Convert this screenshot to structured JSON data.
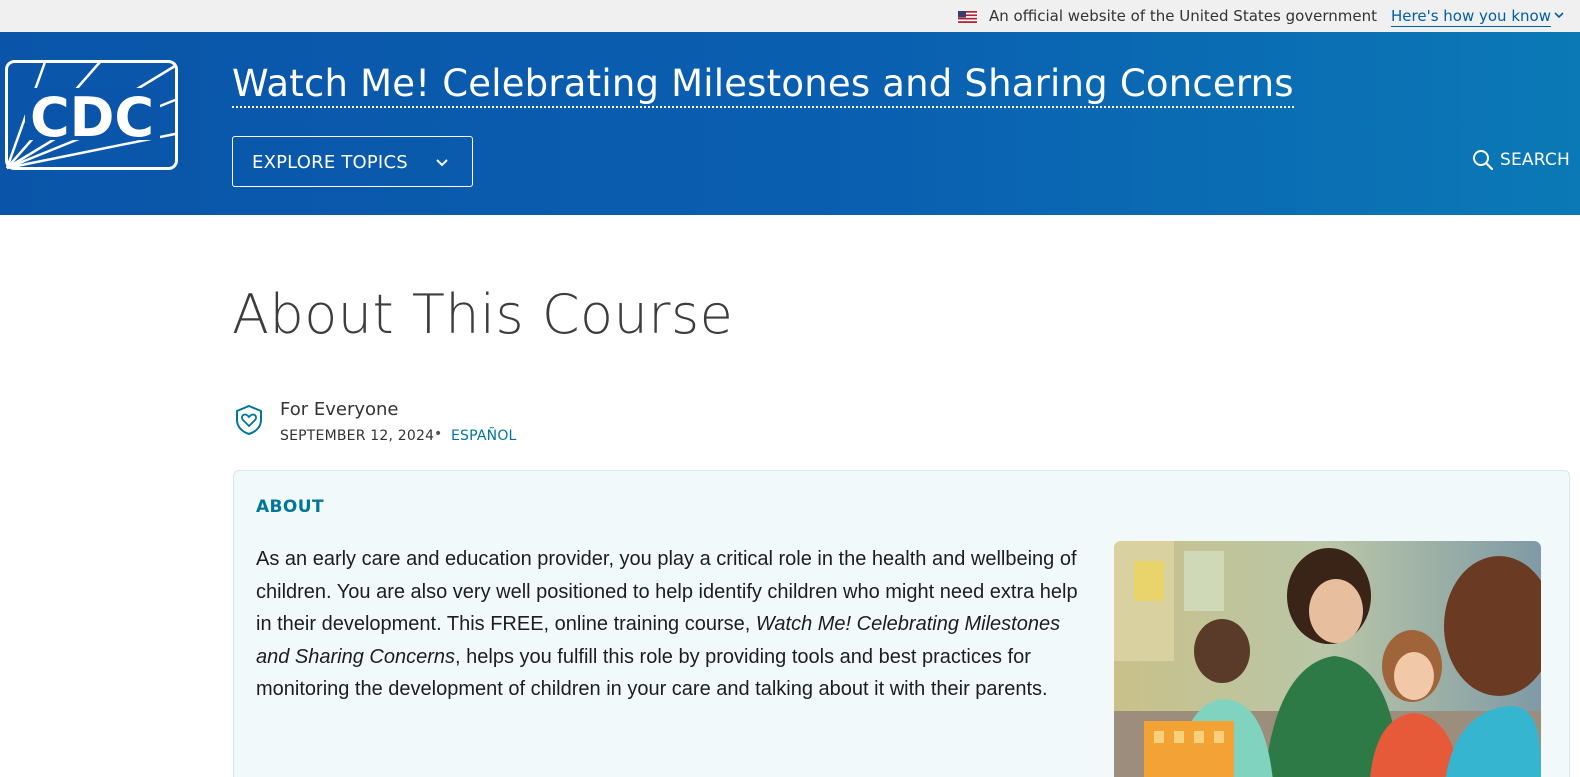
{
  "gov_banner": {
    "official_text": "An official website of the United States government",
    "how_you_know_link": "Here's how you know"
  },
  "header": {
    "logo_text": "CDC",
    "site_title": "Watch Me! Celebrating Milestones and Sharing Concerns",
    "explore_label": "EXPLORE TOPICS",
    "search_label": "SEARCH"
  },
  "page": {
    "title": "About This Course",
    "audience": "For Everyone",
    "date": "SEPTEMBER 12, 2024",
    "separator": "•",
    "language_link": "ESPAÑOL"
  },
  "about": {
    "heading": "ABOUT",
    "text_before_italic": "As an early care and education provider, you play a critical role in the health and wellbeing of children. You are also very well positioned to help identify children who might need extra help in their development. This FREE, online training course, ",
    "text_italic": "Watch Me! Celebrating Milestones and Sharing Concerns",
    "text_after_italic": ", helps you fulfill this role by providing tools and best practices for monitoring the development of children in your care and talking about it with their parents."
  },
  "colors": {
    "header_start": "#0a55a9",
    "header_end": "#0b79b6",
    "accent": "#00779a",
    "about_bg": "#f1f9fb"
  },
  "icons": {
    "flag": "us-flag-icon",
    "chevron": "chevron-down-icon",
    "search": "search-icon",
    "audience": "shield-heart-icon"
  }
}
